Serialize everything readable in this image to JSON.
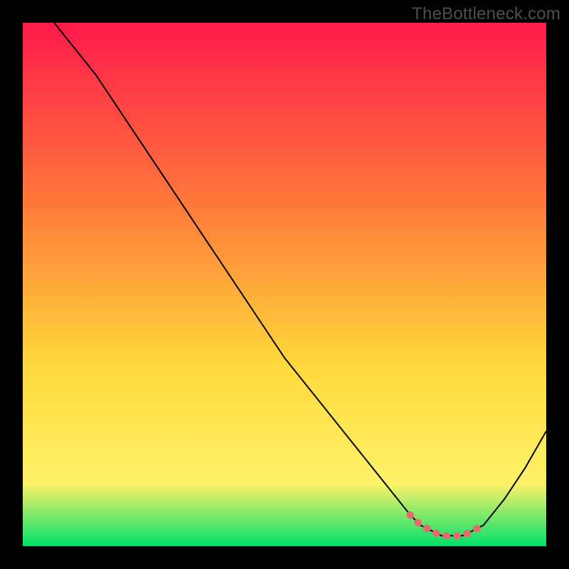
{
  "watermark": "TheBottleneck.com",
  "colors": {
    "gradient_top": "#ff1a4b",
    "gradient_mid1": "#ff7a3a",
    "gradient_mid2": "#ffd83a",
    "gradient_mid3": "#fff26a",
    "gradient_bottom": "#00e06a",
    "curve": "#000000",
    "optimal_marker": "#e86a6f"
  },
  "chart_data": {
    "type": "line",
    "title": "",
    "xlabel": "",
    "ylabel": "",
    "xlim": [
      0,
      100
    ],
    "ylim": [
      0,
      100
    ],
    "series": [
      {
        "name": "bottleneck_curve",
        "x": [
          6,
          10,
          14,
          18,
          22,
          26,
          30,
          34,
          38,
          42,
          46,
          50,
          54,
          58,
          62,
          66,
          70,
          74,
          76,
          78,
          80,
          82,
          84,
          86,
          88,
          92,
          96,
          100
        ],
        "values": [
          100,
          95,
          90,
          84,
          78,
          72,
          66,
          60,
          54,
          48,
          42,
          36,
          31,
          26,
          21,
          16,
          11,
          6,
          4,
          3,
          2,
          2,
          2,
          3,
          4,
          9,
          15,
          22
        ]
      }
    ],
    "optimal_zone": {
      "x_start": 72,
      "x_end": 89
    }
  }
}
